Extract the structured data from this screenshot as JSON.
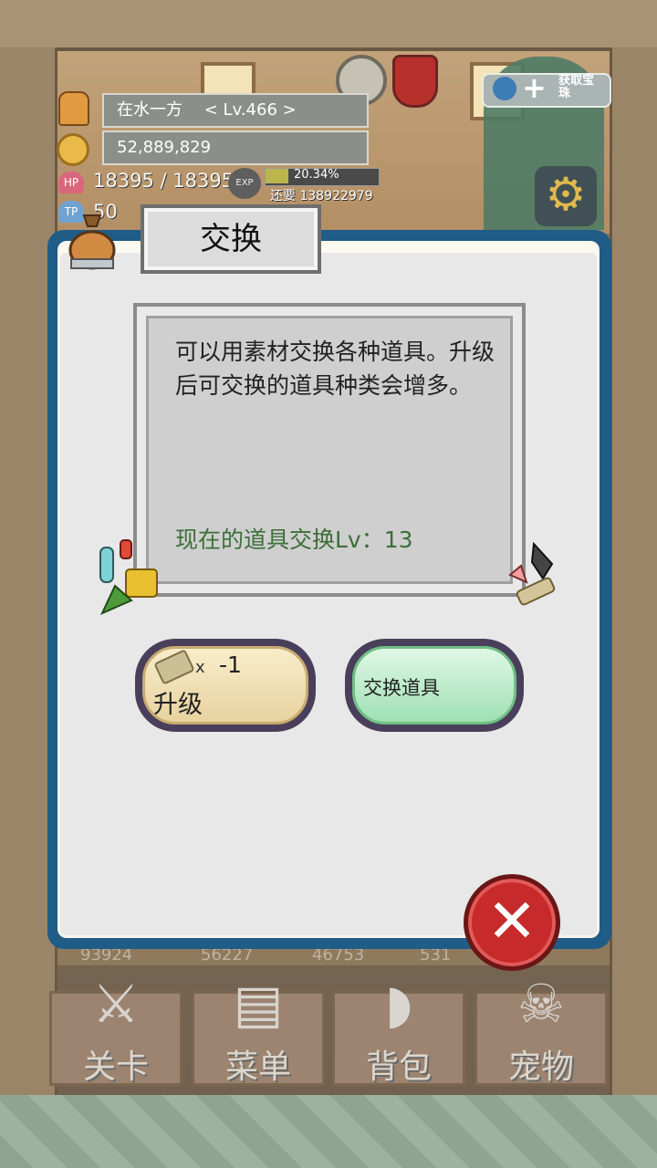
{
  "player": {
    "name": "在水一方",
    "level": "< Lv.466 >",
    "gold": "52,889,829",
    "hp": "18395 / 18395",
    "tp_partial": "50",
    "exp_percent": "20.34%",
    "exp_need": "还要 138922979",
    "hp_icon": "HP",
    "tp_icon": "TP",
    "exp_icon": "EXP",
    "exp_fraction": 0.2034
  },
  "top_right": {
    "get_label": "获取宝珠"
  },
  "dialog": {
    "title": "交换",
    "description": "可以用素材交换各种道具。升级后可交换的道具种类会增多。",
    "level_label": "现在的道具交换Lv：13",
    "upgrade": {
      "cost_prefix": "x",
      "cost": "-1",
      "label": "升级"
    },
    "exchange_label": "交换道具"
  },
  "resources": [
    "93924",
    "56227",
    "46753",
    "531"
  ],
  "nav": [
    {
      "label": "关卡",
      "icon": "crossed-swords-icon"
    },
    {
      "label": "菜单",
      "icon": "book-icon"
    },
    {
      "label": "背包",
      "icon": "backpack-icon"
    },
    {
      "label": "宠物",
      "icon": "dragon-skull-icon"
    }
  ],
  "colors": {
    "dialog_border": "#1f5c88",
    "close_button": "#c62a2a",
    "exchange_button": "#9fe0b2",
    "upgrade_button": "#e8d3a0",
    "level_text": "#3e6e3a"
  }
}
